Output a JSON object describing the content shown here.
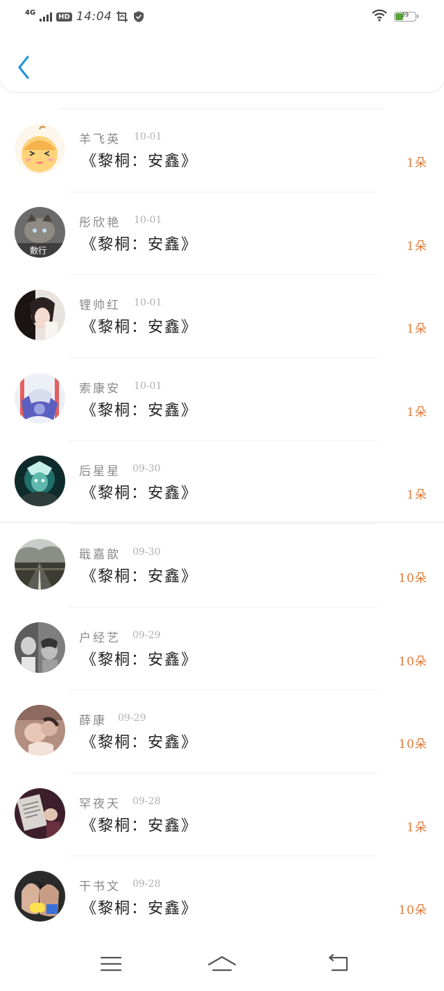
{
  "status_bar": {
    "network": "4G",
    "hd": "HD",
    "time": "14:04",
    "battery": "39",
    "icons": [
      "signal-icon",
      "hd-icon",
      "screenshot-icon",
      "shield-icon",
      "wifi-icon",
      "battery-icon"
    ]
  },
  "header": {
    "back_icon": "chevron-left-icon"
  },
  "colors": {
    "accent": "#2196d9",
    "count": "#e07a36",
    "name": "#888888",
    "date": "#b0b0b0"
  },
  "gifts": [
    {
      "name": "羊飞英",
      "date": "10-01",
      "title": "《黎桐：安鑫》",
      "count": "1朵"
    },
    {
      "name": "彤欣艳",
      "date": "10-01",
      "title": "《黎桐：安鑫》",
      "count": "1朵"
    },
    {
      "name": "锂帅红",
      "date": "10-01",
      "title": "《黎桐：安鑫》",
      "count": "1朵"
    },
    {
      "name": "索康安",
      "date": "10-01",
      "title": "《黎桐：安鑫》",
      "count": "1朵"
    },
    {
      "name": "后星星",
      "date": "09-30",
      "title": "《黎桐：安鑫》",
      "count": "1朵"
    },
    {
      "name": "戢嘉歆",
      "date": "09-30",
      "title": "《黎桐：安鑫》",
      "count": "10朵"
    },
    {
      "name": "户经艺",
      "date": "09-29",
      "title": "《黎桐：安鑫》",
      "count": "10朵"
    },
    {
      "name": "薛康",
      "date": "09-29",
      "title": "《黎桐：安鑫》",
      "count": "10朵"
    },
    {
      "name": "罕夜天",
      "date": "09-28",
      "title": "《黎桐：安鑫》",
      "count": "1朵"
    },
    {
      "name": "干书文",
      "date": "09-28",
      "title": "《黎桐：安鑫》",
      "count": "10朵"
    }
  ],
  "avatar_images": {
    "0": {
      "text": ""
    },
    "1": {
      "text": "敷行"
    }
  },
  "nav": {
    "icons": [
      "menu-icon",
      "home-icon",
      "back-icon"
    ]
  }
}
